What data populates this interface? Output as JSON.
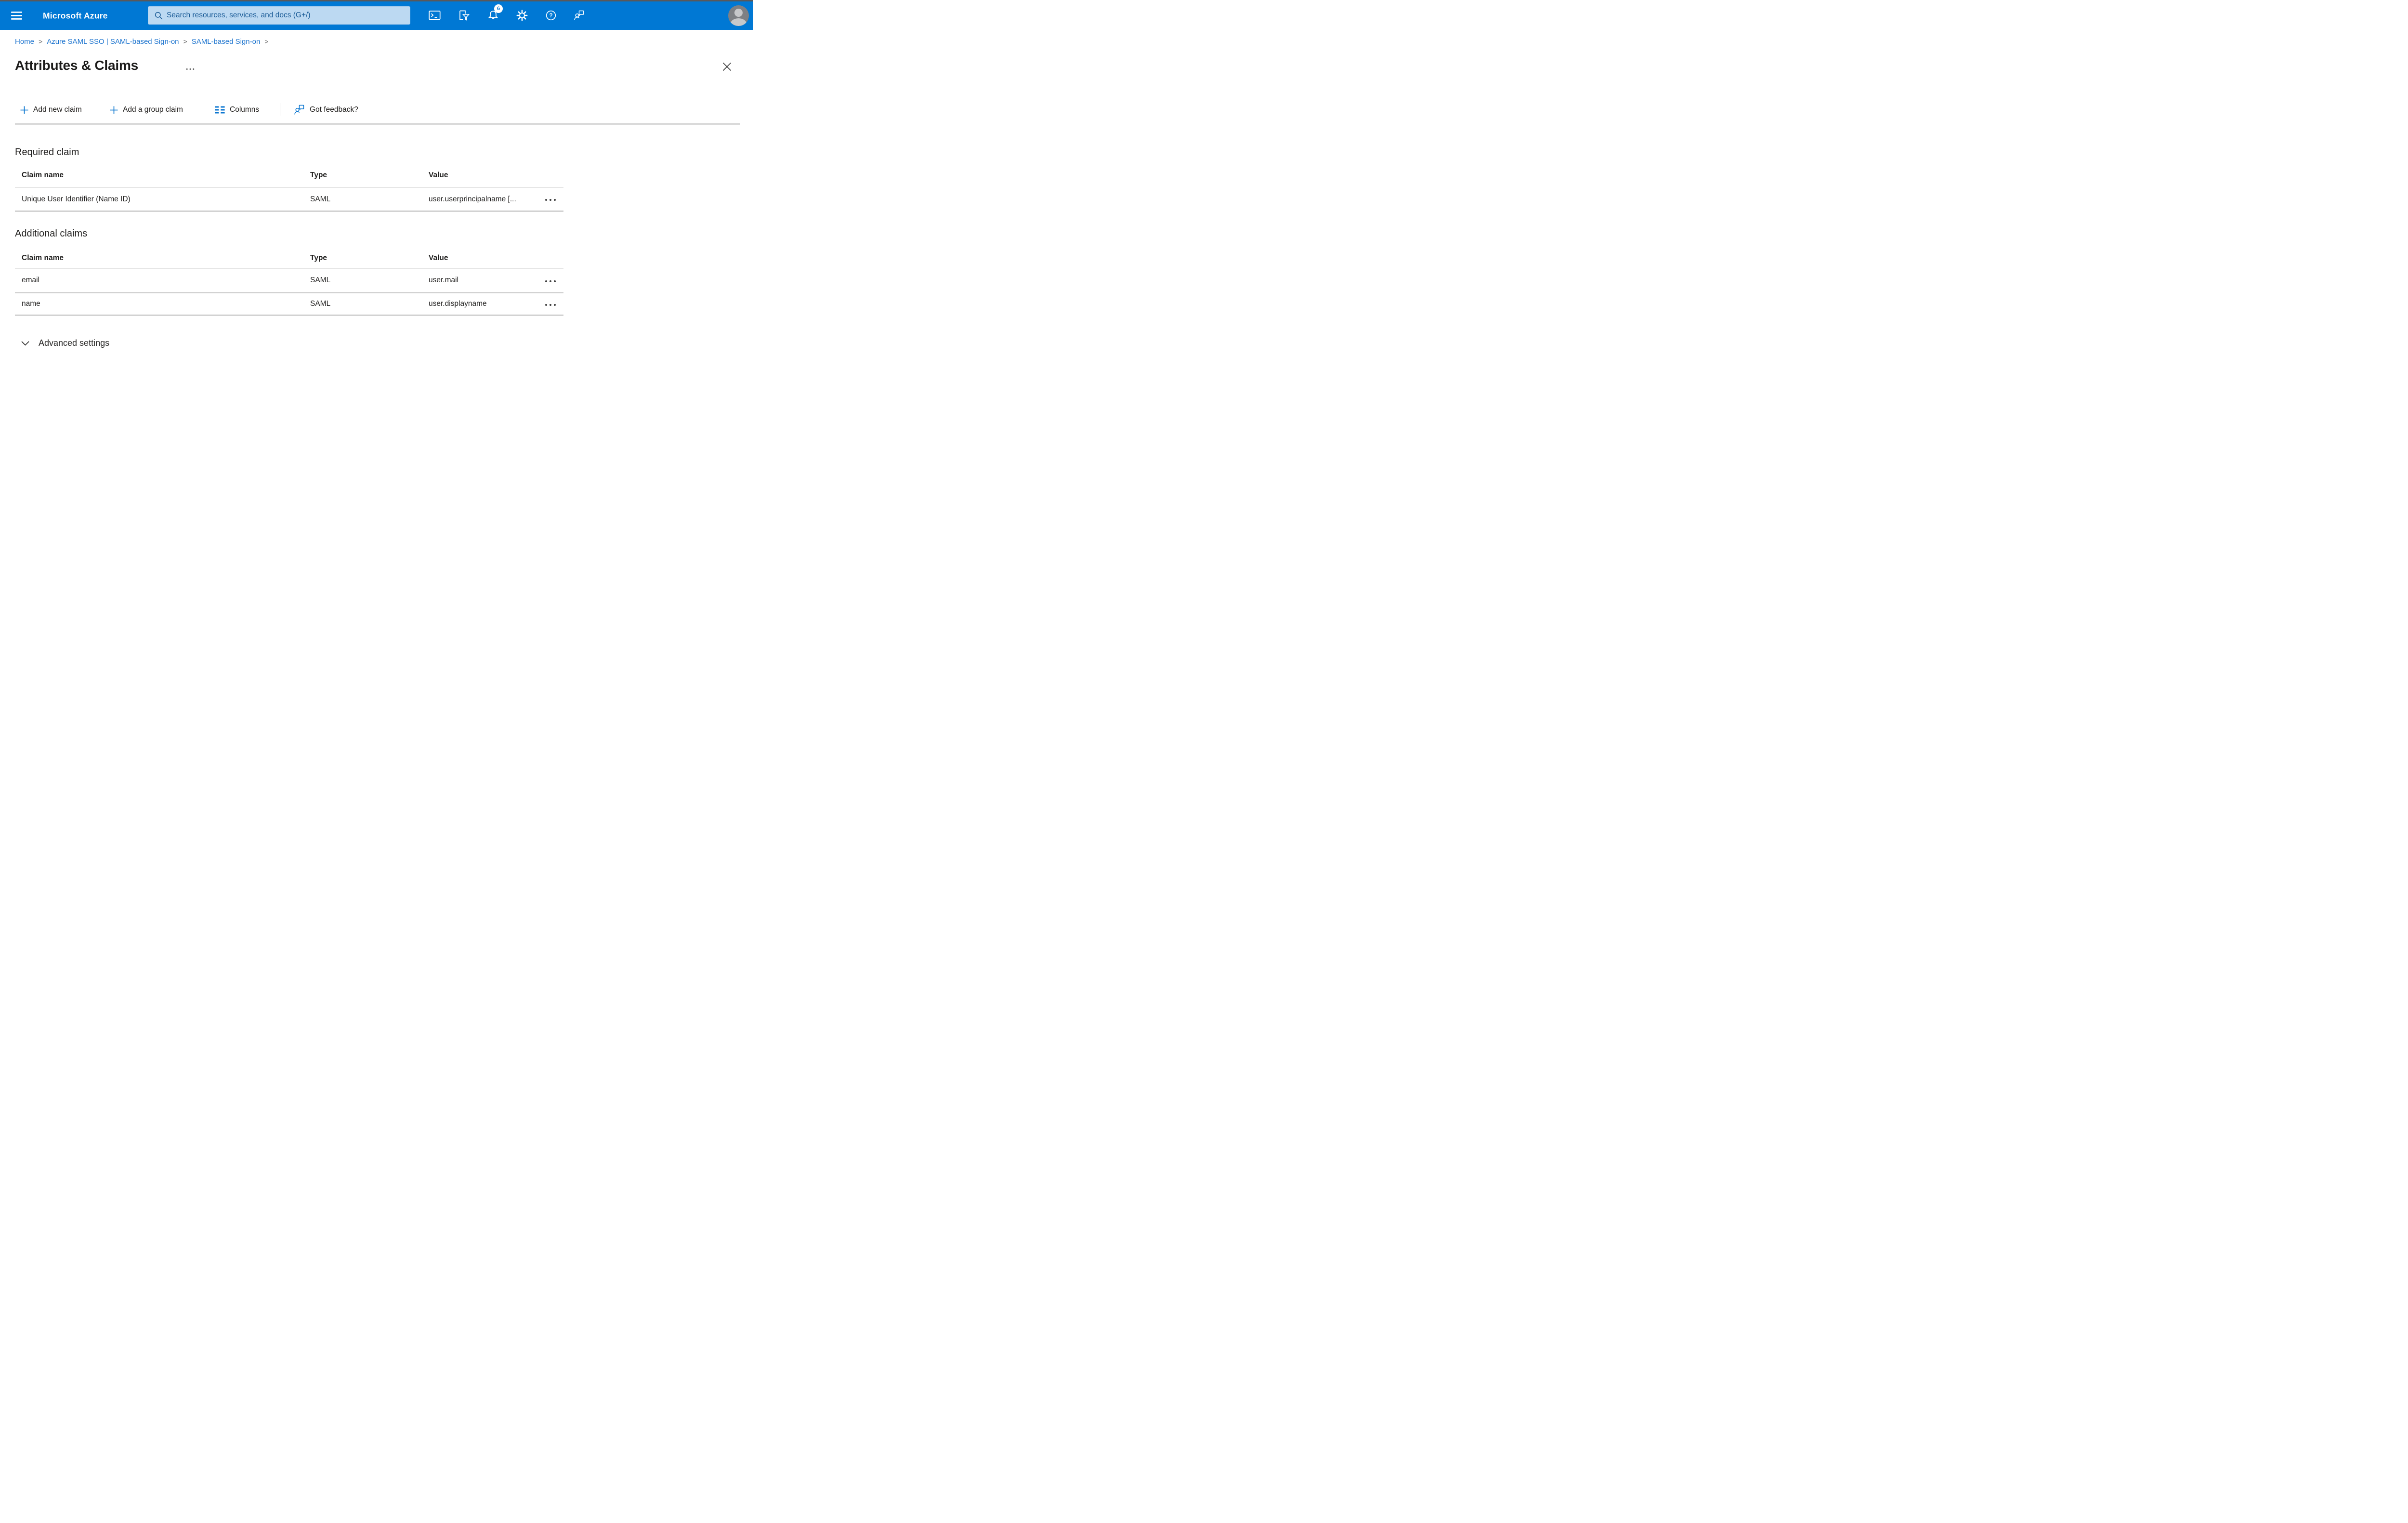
{
  "header": {
    "product_name": "Microsoft Azure",
    "search": {
      "placeholder": "Search resources, services, and docs (G+/)"
    },
    "notifications": {
      "badge_count": "6"
    },
    "colors": {
      "brand_blue": "#0078d4",
      "search_field_bg": "#bcd9f2",
      "search_field_text": "#185a96",
      "link_blue": "#1b73ce"
    }
  },
  "breadcrumb": {
    "separator": ">",
    "items": [
      {
        "label": "Home"
      },
      {
        "label": "Azure SAML SSO | SAML-based Sign-on"
      },
      {
        "label": "SAML-based Sign-on"
      }
    ]
  },
  "page": {
    "title": "Attributes & Claims"
  },
  "toolbar": {
    "buttons": [
      {
        "label": "Add new claim",
        "icon": "plus-icon"
      },
      {
        "label": "Add a group claim",
        "icon": "plus-icon"
      },
      {
        "label": "Columns",
        "icon": "columns-icon"
      },
      {
        "label": "Got feedback?",
        "icon": "feedback-icon"
      }
    ]
  },
  "required_claim": {
    "title": "Required claim",
    "columns": [
      "Claim name",
      "Type",
      "Value"
    ],
    "rows": [
      {
        "claim_name": "Unique User Identifier (Name ID)",
        "type": "SAML",
        "value": "user.userprincipalname [..."
      }
    ]
  },
  "additional_claims": {
    "title": "Additional claims",
    "columns": [
      "Claim name",
      "Type",
      "Value"
    ],
    "rows": [
      {
        "claim_name": "email",
        "type": "SAML",
        "value": "user.mail"
      },
      {
        "claim_name": "name",
        "type": "SAML",
        "value": "user.displayname"
      }
    ]
  },
  "advanced": {
    "label": "Advanced settings"
  },
  "icons": {
    "top_bar": [
      "hamburger-icon",
      "search-icon",
      "cloud-shell-icon",
      "directory-filter-icon",
      "bell-icon",
      "gear-icon",
      "help-icon",
      "feedback-icon",
      "avatar"
    ],
    "page": [
      "more-options-icon",
      "close-icon",
      "plus-icon",
      "columns-icon",
      "feedback-icon",
      "row-menu-icon",
      "chevron-down-icon"
    ]
  }
}
